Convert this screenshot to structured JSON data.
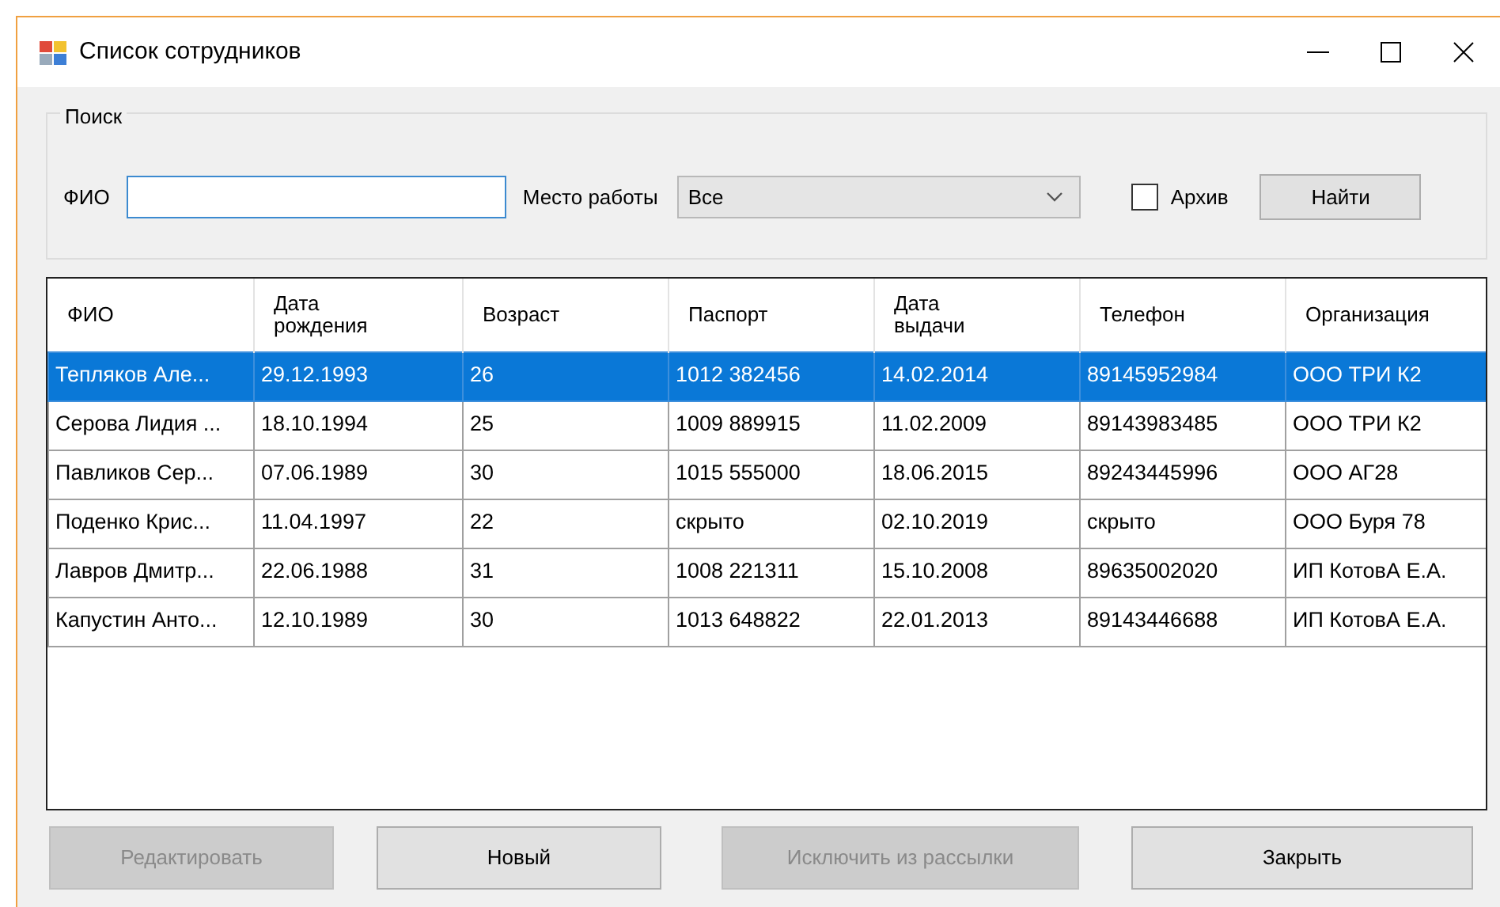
{
  "window": {
    "title": "Список сотрудников"
  },
  "search": {
    "title": "Поиск",
    "fio_label": "ФИО",
    "workplace_label": "Место работы",
    "workplace_value": "Все",
    "archive": {
      "label": "Архив",
      "checked": false
    },
    "find_button": "Найти"
  },
  "table": {
    "columns": [
      "ФИО",
      "Дата рождения",
      "Возраст",
      "Паспорт",
      "Дата выдачи",
      "Телефон",
      "Организация"
    ],
    "rows": [
      {
        "selected": true,
        "cells": [
          "Тепляков Але...",
          "29.12.1993",
          "26",
          "1012 382456",
          "14.02.2014",
          "89145952984",
          "ООО ТРИ К2"
        ]
      },
      {
        "selected": false,
        "cells": [
          "Серова Лидия ...",
          "18.10.1994",
          "25",
          "1009 889915",
          "11.02.2009",
          "89143983485",
          "ООО ТРИ К2"
        ]
      },
      {
        "selected": false,
        "cells": [
          "Павликов Сер...",
          "07.06.1989",
          "30",
          "1015 555000",
          "18.06.2015",
          "89243445996",
          "ООО АГ28"
        ]
      },
      {
        "selected": false,
        "cells": [
          "Поденко Крис...",
          "11.04.1997",
          "22",
          "скрыто",
          "02.10.2019",
          "скрыто",
          "ООО Буря 78"
        ]
      },
      {
        "selected": false,
        "cells": [
          "Лавров Дмитр...",
          "22.06.1988",
          "31",
          "1008 221311",
          "15.10.2008",
          "89635002020",
          "ИП КотовА Е.А."
        ]
      },
      {
        "selected": false,
        "cells": [
          "Капустин Анто...",
          "12.10.1989",
          "30",
          "1013 648822",
          "22.01.2013",
          "89143446688",
          "ИП КотовА Е.А."
        ]
      }
    ]
  },
  "buttons": [
    {
      "label": "Редактировать",
      "disabled": true
    },
    {
      "label": "Новый",
      "disabled": false
    },
    {
      "label": "Исключить из рассылки",
      "disabled": true
    },
    {
      "label": "Закрыть",
      "disabled": false
    }
  ]
}
